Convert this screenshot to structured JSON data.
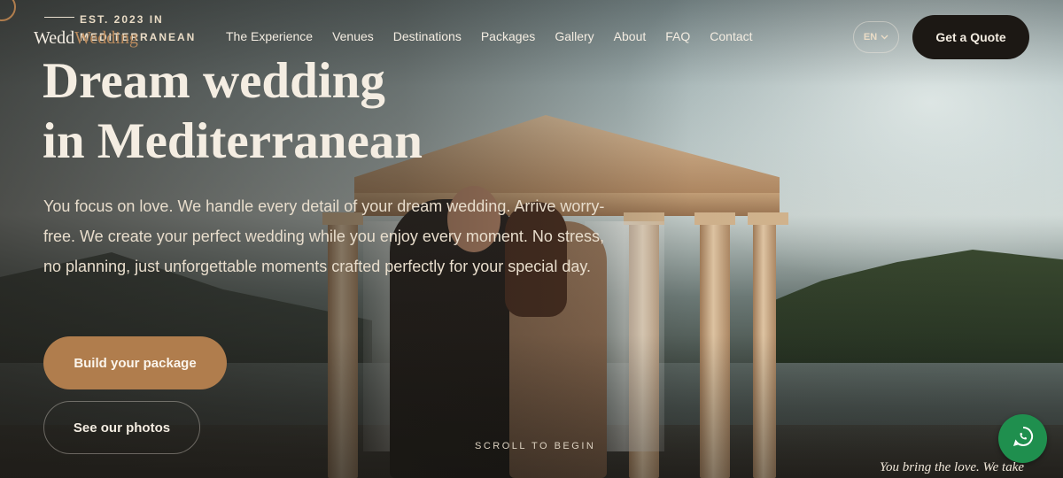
{
  "brand": {
    "est": "EST. 2023 IN MEDITERRANEAN",
    "name_part1": "Wedd",
    "name_part2": "Wedding"
  },
  "nav": {
    "items": [
      {
        "label": "The Experience"
      },
      {
        "label": "Venues"
      },
      {
        "label": "Destinations"
      },
      {
        "label": "Packages"
      },
      {
        "label": "Gallery"
      },
      {
        "label": "About"
      },
      {
        "label": "FAQ"
      },
      {
        "label": "Contact"
      }
    ]
  },
  "header": {
    "language": "EN",
    "quote_label": "Get a Quote"
  },
  "hero": {
    "headline_line1": "Dream wedding",
    "headline_line2": "in Mediterranean",
    "intro": "You focus on love. We handle every detail of your dream wedding. Arrive worry-free. We create your perfect wedding while you enjoy every moment. No stress, no planning, just unforgettable moments crafted perfectly for your special day.",
    "primary_label": "Build your package",
    "secondary_label": "See our photos",
    "scroll_hint": "SCROLL TO BEGIN",
    "tagline": "You bring the love. We take"
  },
  "colors": {
    "accent": "#b07d4d",
    "dark_button": "#1c1814",
    "whatsapp": "#1f8f4e"
  },
  "icons": {
    "language_chevron": "chevron-down-icon",
    "chat": "whatsapp-icon"
  }
}
